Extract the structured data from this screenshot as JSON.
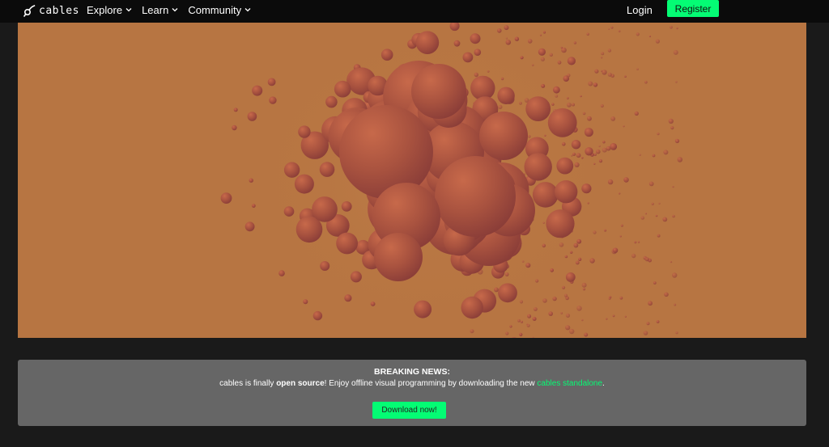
{
  "header": {
    "logo_text": "cables",
    "nav": [
      {
        "label": "Explore"
      },
      {
        "label": "Learn"
      },
      {
        "label": "Community"
      }
    ],
    "login_label": "Login",
    "register_label": "Register"
  },
  "news": {
    "title": "BREAKING NEWS:",
    "text_before": "cables is finally ",
    "text_bold": "open source",
    "text_middle": "! Enjoy offline visual programming by downloading the new ",
    "link_text": "cables standalone",
    "text_after": ".",
    "button_label": "Download now!"
  },
  "colors": {
    "accent": "#04fc74",
    "hero_background": "#b77542",
    "sphere": "#a6513f",
    "panel": "#666666",
    "topbar": "#0b0b0b",
    "page": "#1a1a1a"
  },
  "icons": {
    "logo": "cables-logo-icon",
    "dropdown": "chevron-down-icon"
  }
}
